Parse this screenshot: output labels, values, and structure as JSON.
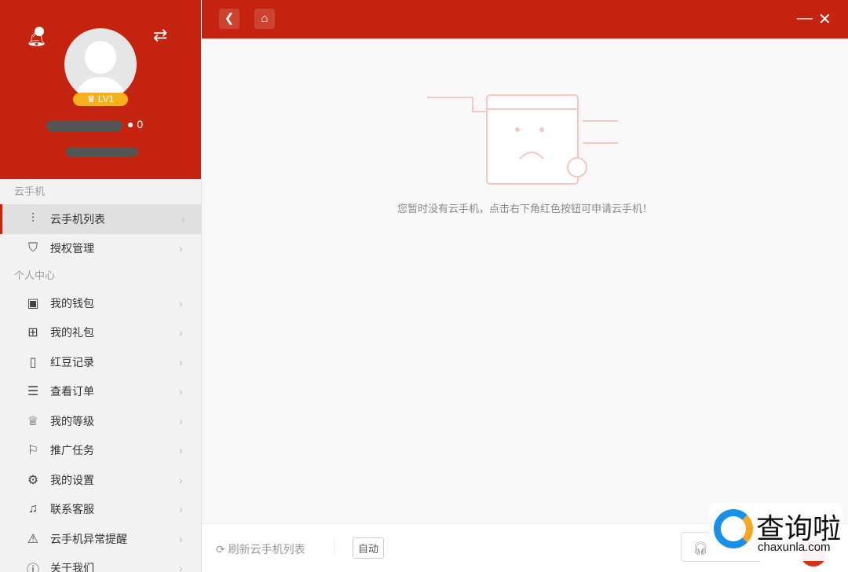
{
  "profile": {
    "level": "LV1",
    "beans": "0"
  },
  "sidebar": {
    "section1": "云手机",
    "section2": "个人中心",
    "items1": [
      {
        "label": "云手机列表",
        "icon": "sliders-icon"
      },
      {
        "label": "授权管理",
        "icon": "shield-icon"
      }
    ],
    "items2": [
      {
        "label": "我的钱包",
        "icon": "wallet-icon"
      },
      {
        "label": "我的礼包",
        "icon": "gift-icon"
      },
      {
        "label": "红豆记录",
        "icon": "record-icon"
      },
      {
        "label": "查看订单",
        "icon": "order-icon"
      },
      {
        "label": "我的等级",
        "icon": "crown-icon"
      },
      {
        "label": "推广任务",
        "icon": "flag-icon"
      },
      {
        "label": "我的设置",
        "icon": "gear-icon"
      },
      {
        "label": "联系客服",
        "icon": "headset-icon"
      },
      {
        "label": "云手机异常提醒",
        "icon": "warning-icon"
      },
      {
        "label": "关于我们",
        "icon": "info-icon"
      }
    ]
  },
  "main": {
    "empty_message": "您暂时没有云手机，点击右下角红色按钮可申请云手机！"
  },
  "footer": {
    "refresh": "刷新云手机列表",
    "auto": "自动"
  },
  "watermark": {
    "title": "查询啦",
    "url": "chaxunla.com"
  }
}
